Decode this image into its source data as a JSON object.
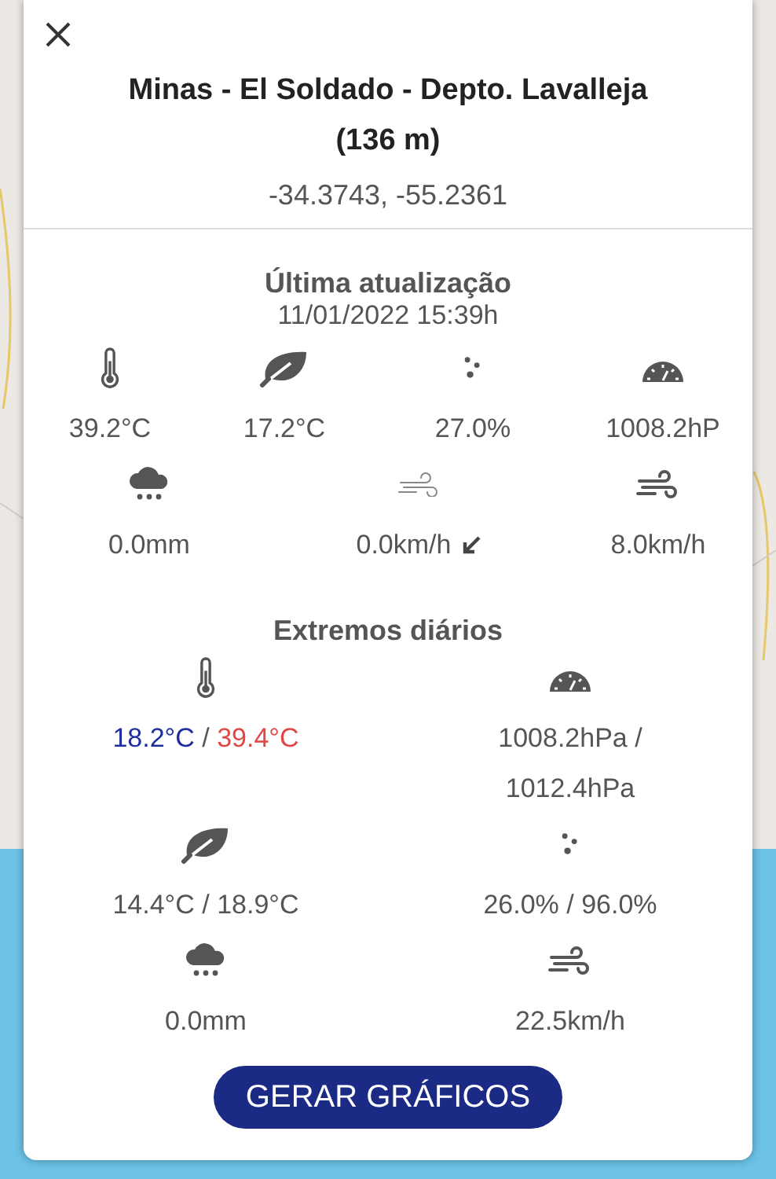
{
  "station": {
    "name": "Minas - El Soldado - Depto. Lavalleja (136 m)",
    "coords": "-34.3743, -55.2361"
  },
  "current": {
    "title": "Última atualização",
    "timestamp": "11/01/2022 15:39h",
    "readings": [
      {
        "kind": "temperature",
        "value": "39.2°C"
      },
      {
        "kind": "dew_point",
        "value": "17.2°C"
      },
      {
        "kind": "humidity",
        "value": "27.0%"
      },
      {
        "kind": "pressure",
        "value": "1008.2hP"
      },
      {
        "kind": "rain",
        "value": "0.0mm"
      },
      {
        "kind": "wind",
        "value": "0.0km/h"
      },
      {
        "kind": "gust",
        "value": "8.0km/h"
      }
    ]
  },
  "extremes": {
    "title": "Extremos diários",
    "items": [
      {
        "kind": "temperature",
        "min": "18.2°C",
        "separator": "/",
        "max": "39.4°C"
      },
      {
        "kind": "pressure",
        "min": "1008.2hPa",
        "separator": "/",
        "max": "1012.4hPa"
      },
      {
        "kind": "dew_point",
        "min": "14.4°C",
        "separator": "/",
        "max": "18.9°C"
      },
      {
        "kind": "humidity",
        "min": "26.0%",
        "separator": "/",
        "max": "96.0%"
      },
      {
        "kind": "rain",
        "value": "0.0mm"
      },
      {
        "kind": "gust",
        "value": "22.5km/h"
      }
    ]
  },
  "button": "GERAR GRÁFICOS"
}
